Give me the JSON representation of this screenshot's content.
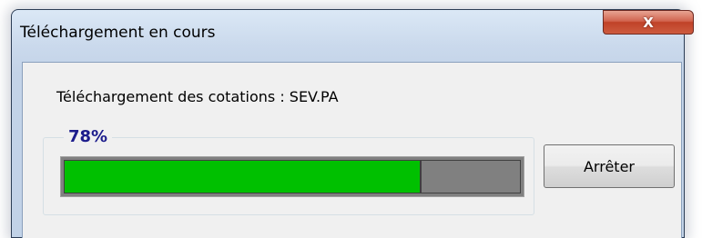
{
  "window": {
    "title": "Téléchargement en cours",
    "close_label": "X"
  },
  "dialog": {
    "message": "Téléchargement des cotations : SEV.PA",
    "progress": {
      "label": "78%",
      "value": 0.78,
      "fill_color": "#00c000",
      "track_color": "#808080"
    },
    "stop_button_label": "Arrêter"
  }
}
